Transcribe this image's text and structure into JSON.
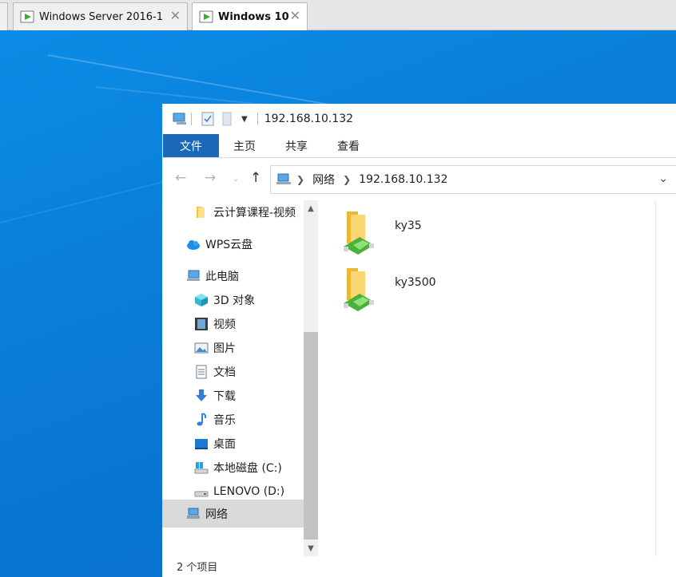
{
  "vm_tabs": [
    {
      "label": "Windows Server 2016-1",
      "active": false
    },
    {
      "label": "Windows 10",
      "active": true
    }
  ],
  "explorer": {
    "title": "192.168.10.132",
    "ribbon_tabs": [
      "文件",
      "主页",
      "共享",
      "查看"
    ],
    "address": {
      "breadcrumbs": [
        "网络",
        "192.168.10.132"
      ]
    },
    "nav_items": [
      {
        "label": "云计算课程-视频",
        "icon": "folder-icon"
      },
      {
        "label": "WPS云盘",
        "icon": "cloud-icon"
      },
      {
        "label": "此电脑",
        "icon": "computer-icon"
      },
      {
        "label": "3D 对象",
        "icon": "3d-objects-icon"
      },
      {
        "label": "视频",
        "icon": "video-icon"
      },
      {
        "label": "图片",
        "icon": "pictures-icon"
      },
      {
        "label": "文档",
        "icon": "documents-icon"
      },
      {
        "label": "下载",
        "icon": "download-icon"
      },
      {
        "label": "音乐",
        "icon": "music-icon"
      },
      {
        "label": "桌面",
        "icon": "desktop-icon"
      },
      {
        "label": "本地磁盘 (C:)",
        "icon": "drive-c-icon"
      },
      {
        "label": "LENOVO (D:)",
        "icon": "drive-d-icon"
      },
      {
        "label": "网络",
        "icon": "network-icon",
        "selected": true
      }
    ],
    "items": [
      {
        "name": "ky35",
        "icon": "shared-folder-icon"
      },
      {
        "name": "ky3500",
        "icon": "shared-folder-icon"
      }
    ],
    "status": "2 个项目"
  },
  "colors": {
    "desktop": "#0a7fd8",
    "file_tab": "#1a69b8",
    "selected": "#d9d9d9"
  }
}
